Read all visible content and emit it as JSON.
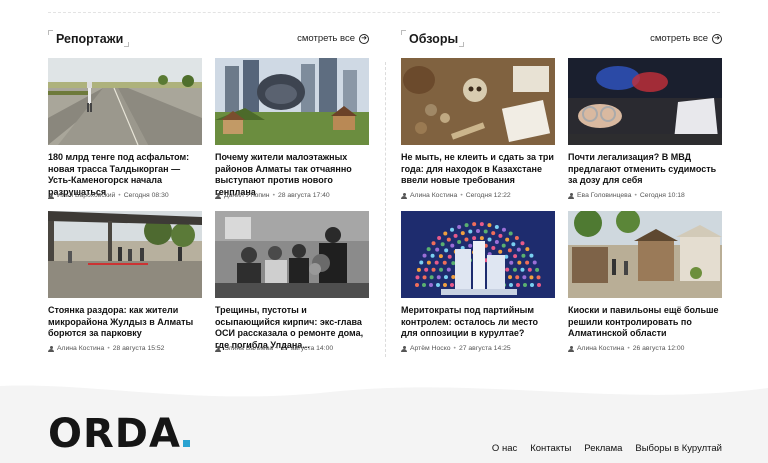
{
  "sections": [
    {
      "title": "Репортажи",
      "see_all": "смотреть все",
      "cards": [
        {
          "title": "180 млрд тенге под асфальтом: новая трасса Талдыкорган — Усть-Каменогорск начала разрушаться",
          "author": "Илья Бароховский",
          "date": "Сегодня 08:30"
        },
        {
          "title": "Почему жители малоэтажных районов Алматы так отчаянно выступают против нового генплана",
          "author": "Данил Утюпин",
          "date": "28 августа 17:40"
        },
        {
          "title": "Стоянка раздора: как жители микрорайона Жулдыз в Алматы борются за парковку",
          "author": "Алина Костина",
          "date": "28 августа 15:52"
        },
        {
          "title": "Трещины, пустоты и осыпающийся кирпич: экс-глава ОСИ рассказала о ремонте дома, где погибла Улдана...",
          "author": "Элина Валиева",
          "date": "27 августа 14:00"
        }
      ]
    },
    {
      "title": "Обзоры",
      "see_all": "смотреть все",
      "cards": [
        {
          "title": "Не мыть, не клеить и сдать за три года: для находок в Казахстане ввели новые требования",
          "author": "Алина Костина",
          "date": "Сегодня 12:22"
        },
        {
          "title": "Почти легализация? В МВД предлагают отменить судимость за дозу для себя",
          "author": "Ева Головинцева",
          "date": "Сегодня 10:18"
        },
        {
          "title": "Меритократы под партийным контролем: осталось ли место для оппозиции в курултае?",
          "author": "Артём Носко",
          "date": "27 августа 14:25"
        },
        {
          "title": "Киоски и павильоны ещё больше решили контролировать по Алматинской области",
          "author": "Алина Костина",
          "date": "26 августа 12:00"
        }
      ]
    }
  ],
  "footer": {
    "logo": "ORDA",
    "links": [
      "О нас",
      "Контакты",
      "Реклама",
      "Выборы в Курултай"
    ]
  }
}
